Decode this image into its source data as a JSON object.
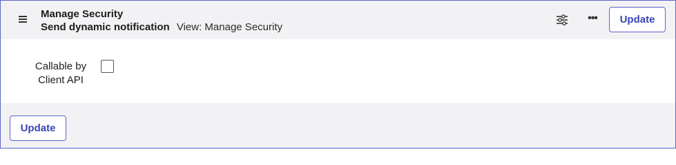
{
  "header": {
    "menu_icon": "hamburger-menu-icon",
    "title": "Manage Security",
    "subtitle": "Send dynamic notification",
    "view_label": "View: Manage Security",
    "settings_icon": "sliders-settings-icon",
    "more_icon": "more-options-icon",
    "more_glyph": "•••",
    "update_label": "Update"
  },
  "form": {
    "field_label_line1": "Callable by",
    "field_label_line2": "Client API",
    "checkbox_checked": false
  },
  "footer": {
    "update_label": "Update"
  },
  "colors": {
    "accent": "#5b63c9",
    "button_text": "#3b45b3",
    "header_bg": "#f2f2f4"
  }
}
